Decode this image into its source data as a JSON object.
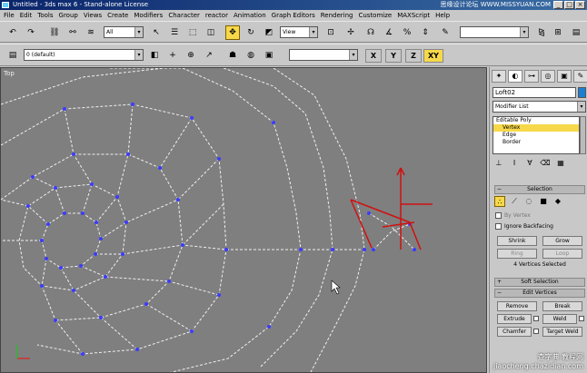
{
  "window": {
    "title": "Untitled - 3ds max 6 - Stand-alone License",
    "watermark": "思缘设计论坛  WWW.MISSYUAN.COM"
  },
  "menu": [
    "File",
    "Edit",
    "Tools",
    "Group",
    "Views",
    "Create",
    "Modifiers",
    "Character",
    "reactor",
    "Animation",
    "Graph Editors",
    "Rendering",
    "Customize",
    "MAXScript",
    "Help"
  ],
  "toolbar1": {
    "selection_filter": "All",
    "ref_coord": "View",
    "named_sel": ""
  },
  "toolbar2": {
    "layer": "0 (default)",
    "selection_set": "",
    "axes": [
      "X",
      "Y",
      "Z",
      "XY"
    ]
  },
  "viewport": {
    "label": "Top"
  },
  "panel": {
    "object_name": "Loft02",
    "modifier_list": "Modifier List",
    "stack": {
      "object": "Editable Poly",
      "items": [
        "Vertex",
        "Edge",
        "Border"
      ]
    },
    "selection": {
      "title": "Selection",
      "by_vertex": "By Vertex",
      "ignore_backfacing": "Ignore Backfacing",
      "shrink": "Shrink",
      "grow": "Grow",
      "ring": "Ring",
      "loop": "Loop",
      "status": "4 Vertices Selected"
    },
    "soft_selection": "Soft Selection",
    "edit_vertices": {
      "title": "Edit Vertices",
      "remove": "Remove",
      "break": "Break",
      "extrude": "Extrude",
      "weld": "Weld",
      "chamfer": "Chamfer",
      "target_weld": "Target Weld"
    }
  },
  "stamp": {
    "line1": "查字典 教程网",
    "line2": "jiaocheng.chazidian.com"
  },
  "colors": {
    "selected": "#f6d84a",
    "viewport_bg": "#7f7f7f",
    "vertex": "#3c3cff",
    "object": "#1a7fd4"
  }
}
